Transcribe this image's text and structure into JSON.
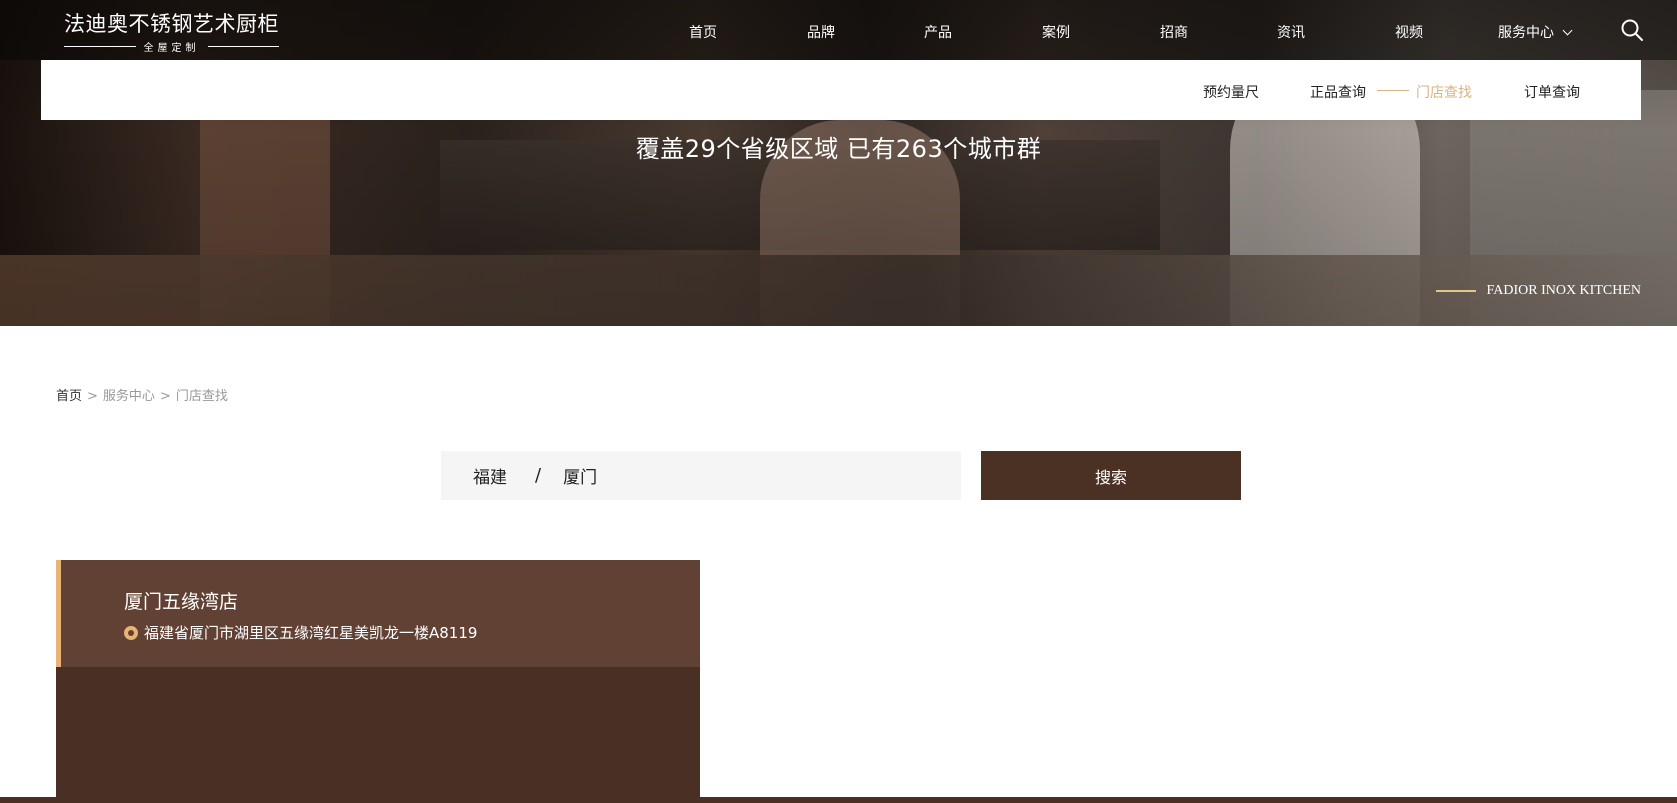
{
  "header": {
    "logo_main": "法迪奥不锈钢艺术厨柜",
    "logo_sub": "全屋定制",
    "nav": [
      "首页",
      "品牌",
      "产品",
      "案例",
      "招商",
      "资讯",
      "视频",
      "服务中心"
    ]
  },
  "subnav": {
    "items": [
      "预约量尺",
      "正品查询",
      "门店查找",
      "订单查询"
    ],
    "active": "门店查找"
  },
  "hero": {
    "headline": "覆盖29个省级区域 已有263个城市群",
    "brand_en": "FADIOR INOX KITCHEN"
  },
  "breadcrumb": {
    "home": "首页",
    "sep": ">",
    "level2": "服务中心",
    "level3": "门店查找"
  },
  "search": {
    "province": "福建",
    "separator": "/",
    "city": "厦门",
    "button": "搜索"
  },
  "stores": [
    {
      "name": "厦门五缘湾店",
      "address": "福建省厦门市湖里区五缘湾红星美凯龙一楼A8119"
    }
  ],
  "colors": {
    "accent": "#e7b475",
    "brand_dark": "#4b3024",
    "card_head": "#614134"
  }
}
